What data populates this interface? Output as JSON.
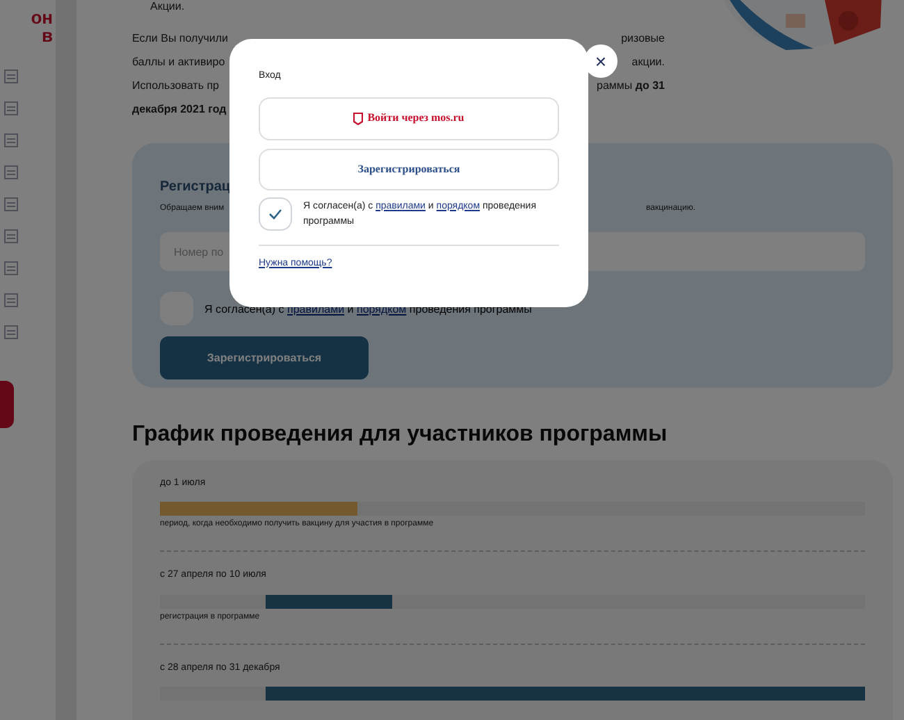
{
  "sidebar": {
    "logo_lines": [
      "он",
      "в"
    ]
  },
  "intro": {
    "line_0": "Акции.",
    "lines": [
      {
        "left": "Если Вы получили",
        "right": "ризовые"
      },
      {
        "left": "баллы и активиро",
        "right": "акции."
      },
      {
        "left": "Использовать пр",
        "right": "раммы",
        "right_bold": "до 31"
      },
      {
        "left_bold": "декабря 2021 год"
      }
    ]
  },
  "registration": {
    "title": "Регистрац",
    "notice_left": "Обращаем вним",
    "notice_right": "вакцинацию.",
    "input_placeholder": "Номер по",
    "consent": {
      "checked": false,
      "prefix": "Я согласен(а) с",
      "link_1": "правилами",
      "middle": "и",
      "link_2": "порядком",
      "suffix": "проведения программы"
    },
    "button": "Зарегистрироваться"
  },
  "schedule": {
    "title": "График проведения для участников программы",
    "rows": [
      {
        "period": "до 1 июля",
        "kind": "vaccination",
        "level": 0.28,
        "caption": "период, когда необходимо получить вакцину для участия в программе"
      },
      {
        "period": "с 27 апреля по 10 июля",
        "kind": "registration",
        "level": 0.18,
        "caption": "регистрация в программе"
      },
      {
        "period": "с 28 апреля по 31 декабря",
        "kind": "participation",
        "level": 0.85
      }
    ]
  },
  "modal": {
    "title": "Вход",
    "close": "×",
    "mos_button": "Войти через mos.ru",
    "register_button": "Зарегистрироваться",
    "consent": {
      "checked": true,
      "prefix": "Я согласен(а) с",
      "link_1": "правилами",
      "middle": "и",
      "link_2": "порядком",
      "suffix": "проведения программы"
    },
    "help_link": "Нужна помощь?"
  }
}
